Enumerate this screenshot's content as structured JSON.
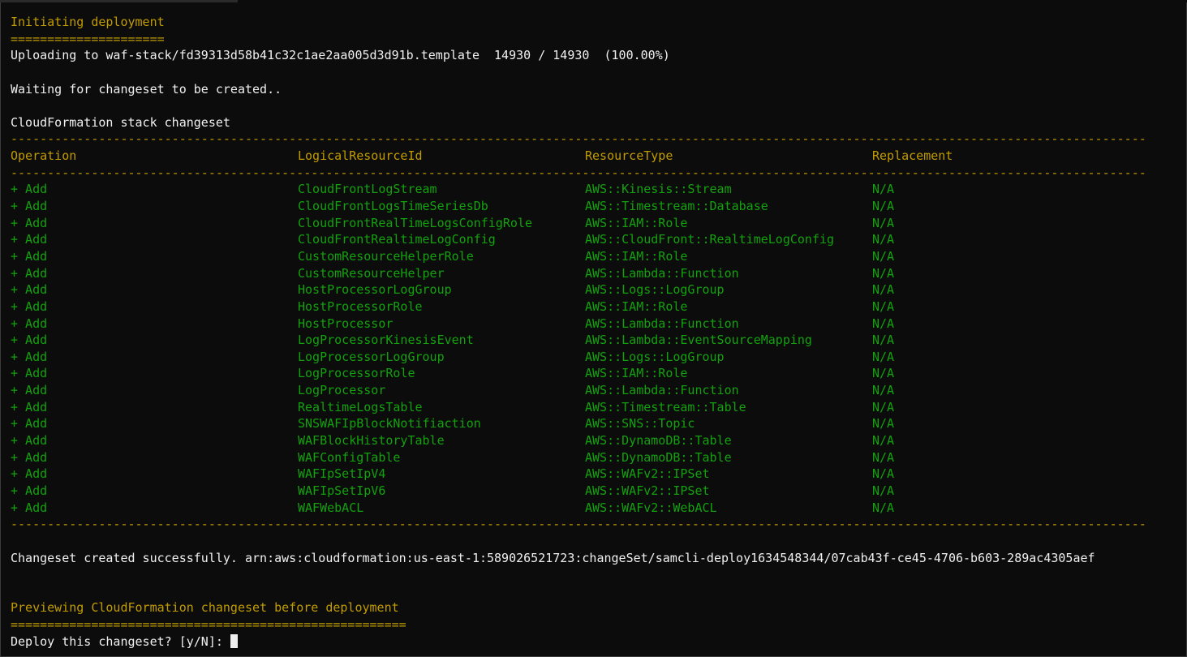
{
  "deploy": {
    "initiating": "Initiating deployment",
    "initiating_rule": "=====================",
    "upload": "Uploading to waf-stack/fd39313d58b41c32c1ae2aa005d3d91b.template  14930 / 14930  (100.00%)",
    "waiting": "Waiting for changeset to be created..",
    "changeset_title": "CloudFormation stack changeset",
    "dash_rule": "-----------------------------------------------------------------------------------------------------------------------------------------------------------",
    "created": "Changeset created successfully. arn:aws:cloudformation:us-east-1:589026521723:changeSet/samcli-deploy1634548344/07cab43f-ce45-4706-b603-289ac4305aef",
    "previewing": "Previewing CloudFormation changeset before deployment",
    "previewing_rule": "======================================================",
    "prompt": "Deploy this changeset? [y/N]: "
  },
  "table": {
    "headers": [
      "Operation",
      "LogicalResourceId",
      "ResourceType",
      "Replacement"
    ],
    "rows": [
      [
        "+ Add",
        "CloudFrontLogStream",
        "AWS::Kinesis::Stream",
        "N/A"
      ],
      [
        "+ Add",
        "CloudFrontLogsTimeSeriesDb",
        "AWS::Timestream::Database",
        "N/A"
      ],
      [
        "+ Add",
        "CloudFrontRealTimeLogsConfigRole",
        "AWS::IAM::Role",
        "N/A"
      ],
      [
        "+ Add",
        "CloudFrontRealtimeLogConfig",
        "AWS::CloudFront::RealtimeLogConfig",
        "N/A"
      ],
      [
        "+ Add",
        "CustomResourceHelperRole",
        "AWS::IAM::Role",
        "N/A"
      ],
      [
        "+ Add",
        "CustomResourceHelper",
        "AWS::Lambda::Function",
        "N/A"
      ],
      [
        "+ Add",
        "HostProcessorLogGroup",
        "AWS::Logs::LogGroup",
        "N/A"
      ],
      [
        "+ Add",
        "HostProcessorRole",
        "AWS::IAM::Role",
        "N/A"
      ],
      [
        "+ Add",
        "HostProcessor",
        "AWS::Lambda::Function",
        "N/A"
      ],
      [
        "+ Add",
        "LogProcessorKinesisEvent",
        "AWS::Lambda::EventSourceMapping",
        "N/A"
      ],
      [
        "+ Add",
        "LogProcessorLogGroup",
        "AWS::Logs::LogGroup",
        "N/A"
      ],
      [
        "+ Add",
        "LogProcessorRole",
        "AWS::IAM::Role",
        "N/A"
      ],
      [
        "+ Add",
        "LogProcessor",
        "AWS::Lambda::Function",
        "N/A"
      ],
      [
        "+ Add",
        "RealtimeLogsTable",
        "AWS::Timestream::Table",
        "N/A"
      ],
      [
        "+ Add",
        "SNSWAFIpBlockNotifiaction",
        "AWS::SNS::Topic",
        "N/A"
      ],
      [
        "+ Add",
        "WAFBlockHistoryTable",
        "AWS::DynamoDB::Table",
        "N/A"
      ],
      [
        "+ Add",
        "WAFConfigTable",
        "AWS::DynamoDB::Table",
        "N/A"
      ],
      [
        "+ Add",
        "WAFIpSetIpV4",
        "AWS::WAFv2::IPSet",
        "N/A"
      ],
      [
        "+ Add",
        "WAFIpSetIpV6",
        "AWS::WAFv2::IPSet",
        "N/A"
      ],
      [
        "+ Add",
        "WAFWebACL",
        "AWS::WAFv2::WebACL",
        "N/A"
      ]
    ]
  },
  "colors": {
    "background": "#0c0c0c",
    "text": "#f0f0f0",
    "heading": "#c19c00",
    "added": "#13a10e"
  }
}
